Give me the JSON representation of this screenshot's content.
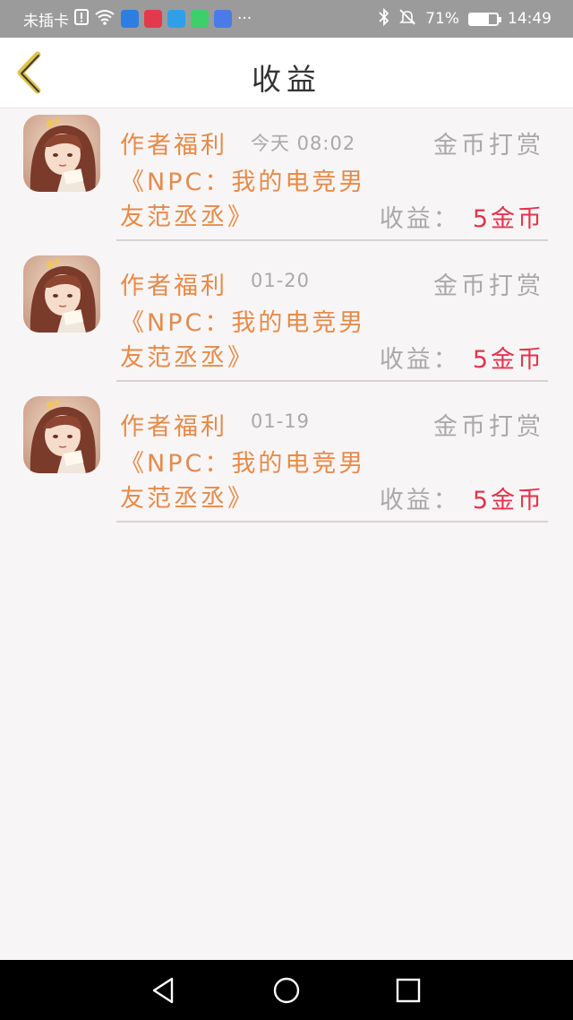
{
  "status_bar": {
    "carrier": "未插卡",
    "more": "···",
    "battery_percent": "71%",
    "battery_level": 0.71,
    "time": "14:49"
  },
  "header": {
    "title": "收益"
  },
  "colors": {
    "accent": "#e58b4a",
    "income": "#e2344d",
    "muted": "#a9a9a9"
  },
  "records": [
    {
      "source": "作者福利",
      "time": "今天 08:02",
      "type": "金币打赏",
      "book": "《NPC：我的电竞男友范丞丞》",
      "income_label": "收益：",
      "income_value": "5金币"
    },
    {
      "source": "作者福利",
      "time": "01-20",
      "type": "金币打赏",
      "book": "《NPC：我的电竞男友范丞丞》",
      "income_label": "收益：",
      "income_value": "5金币"
    },
    {
      "source": "作者福利",
      "time": "01-19",
      "type": "金币打赏",
      "book": "《NPC：我的电竞男友范丞丞》",
      "income_label": "收益：",
      "income_value": "5金币"
    }
  ]
}
